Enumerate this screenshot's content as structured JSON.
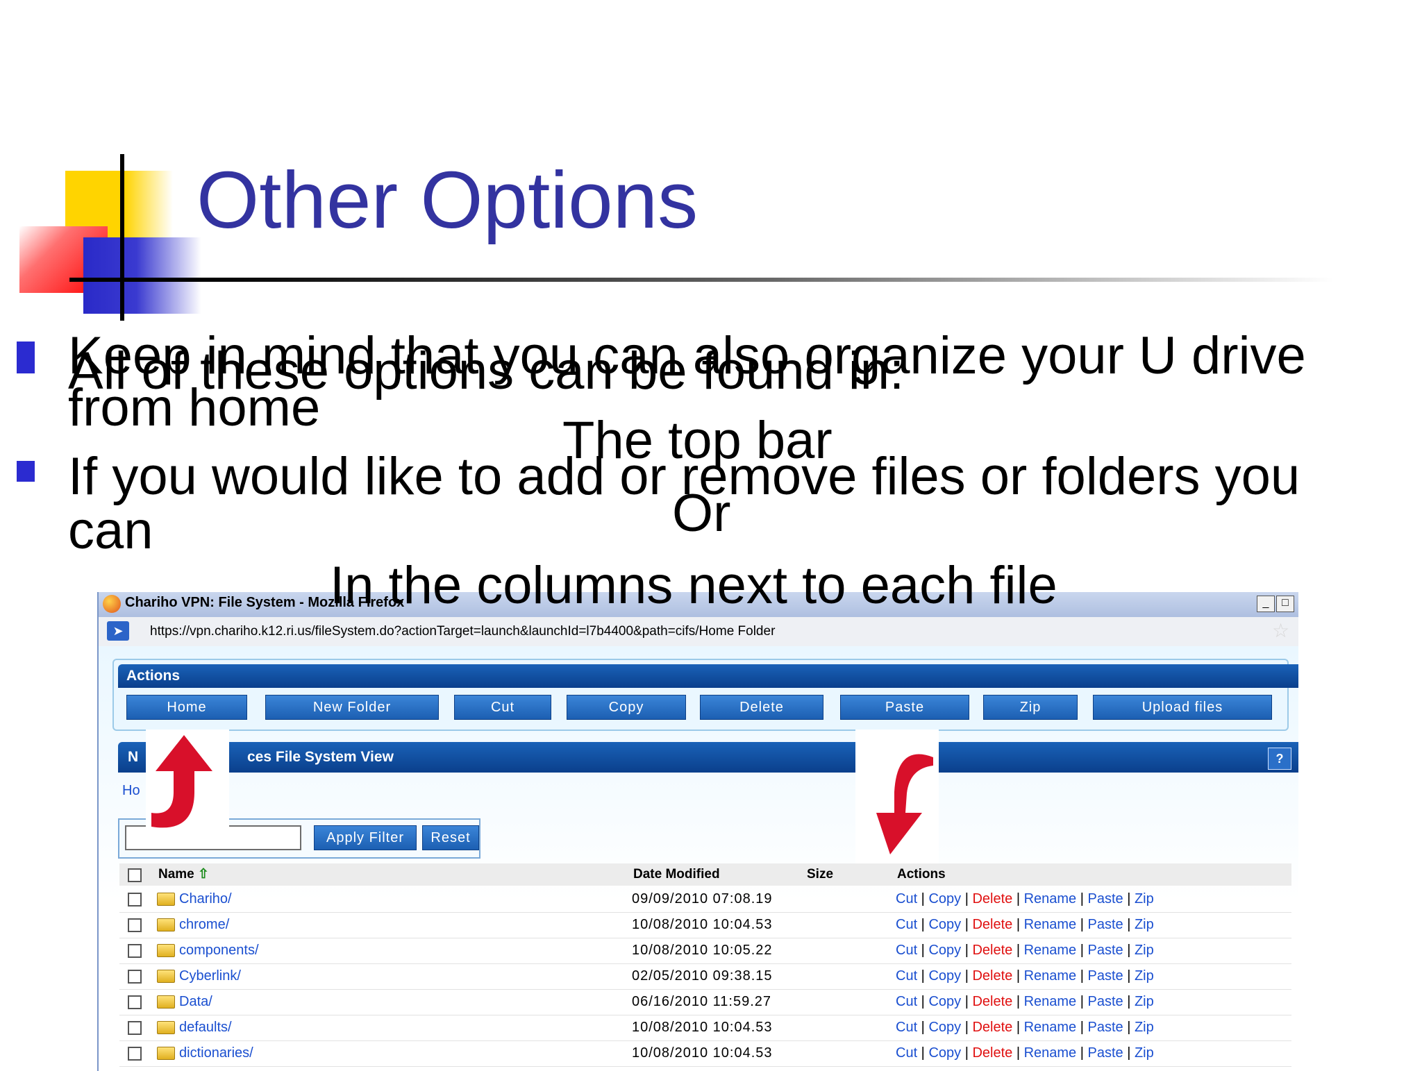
{
  "slide": {
    "title": "Other Options",
    "bullets": [
      {
        "line1": "Keep in mind that you can also organize your U drive",
        "line2": "from home"
      },
      {
        "line1": "If you would like to add or remove files or folders you",
        "line2": "can"
      }
    ],
    "overlay": {
      "line1": "All of these options can be found in:",
      "line2": "The top bar",
      "line3": "Or",
      "line4": "In the columns next to each file"
    }
  },
  "browser": {
    "title": "Chariho VPN: File System - Mozilla Firefox",
    "url": "https://vpn.chariho.k12.ri.us/fileSystem.do?actionTarget=launch&launchId=l7b4400&path=cifs/Home Folder",
    "win_buttons": [
      "_",
      "□"
    ]
  },
  "actions": {
    "header": "Actions",
    "buttons": [
      "Home",
      "New Folder",
      "Cut",
      "Copy",
      "Delete",
      "Paste",
      "Zip",
      "Upload files"
    ]
  },
  "fs_view": {
    "header_left": "N",
    "header_right": "ces File System View",
    "help": "?",
    "breadcrumb_left": "Ho",
    "breadcrumb_right": "/"
  },
  "filter": {
    "apply": "Apply Filter",
    "reset": "Reset"
  },
  "table": {
    "headers": {
      "name": "Name",
      "date": "Date Modified",
      "size": "Size",
      "actions": "Actions"
    },
    "actions": {
      "cut": "Cut",
      "copy": "Copy",
      "delete": "Delete",
      "rename": "Rename",
      "paste": "Paste",
      "zip": "Zip"
    },
    "rows": [
      {
        "name": "Chariho/",
        "date": "09/09/2010 07:08.19"
      },
      {
        "name": "chrome/",
        "date": "10/08/2010 10:04.53"
      },
      {
        "name": "components/",
        "date": "10/08/2010 10:05.22"
      },
      {
        "name": "Cyberlink/",
        "date": "02/05/2010 09:38.15"
      },
      {
        "name": "Data/",
        "date": "06/16/2010 11:59.27"
      },
      {
        "name": "defaults/",
        "date": "10/08/2010 10:04.53"
      },
      {
        "name": "dictionaries/",
        "date": "10/08/2010 10:04.53"
      }
    ]
  },
  "colors": {
    "title": "#3333a0",
    "bullet": "#2b2bd0",
    "link": "#1a4fd0",
    "delete": "#e01010",
    "arrow": "#d8102a"
  }
}
